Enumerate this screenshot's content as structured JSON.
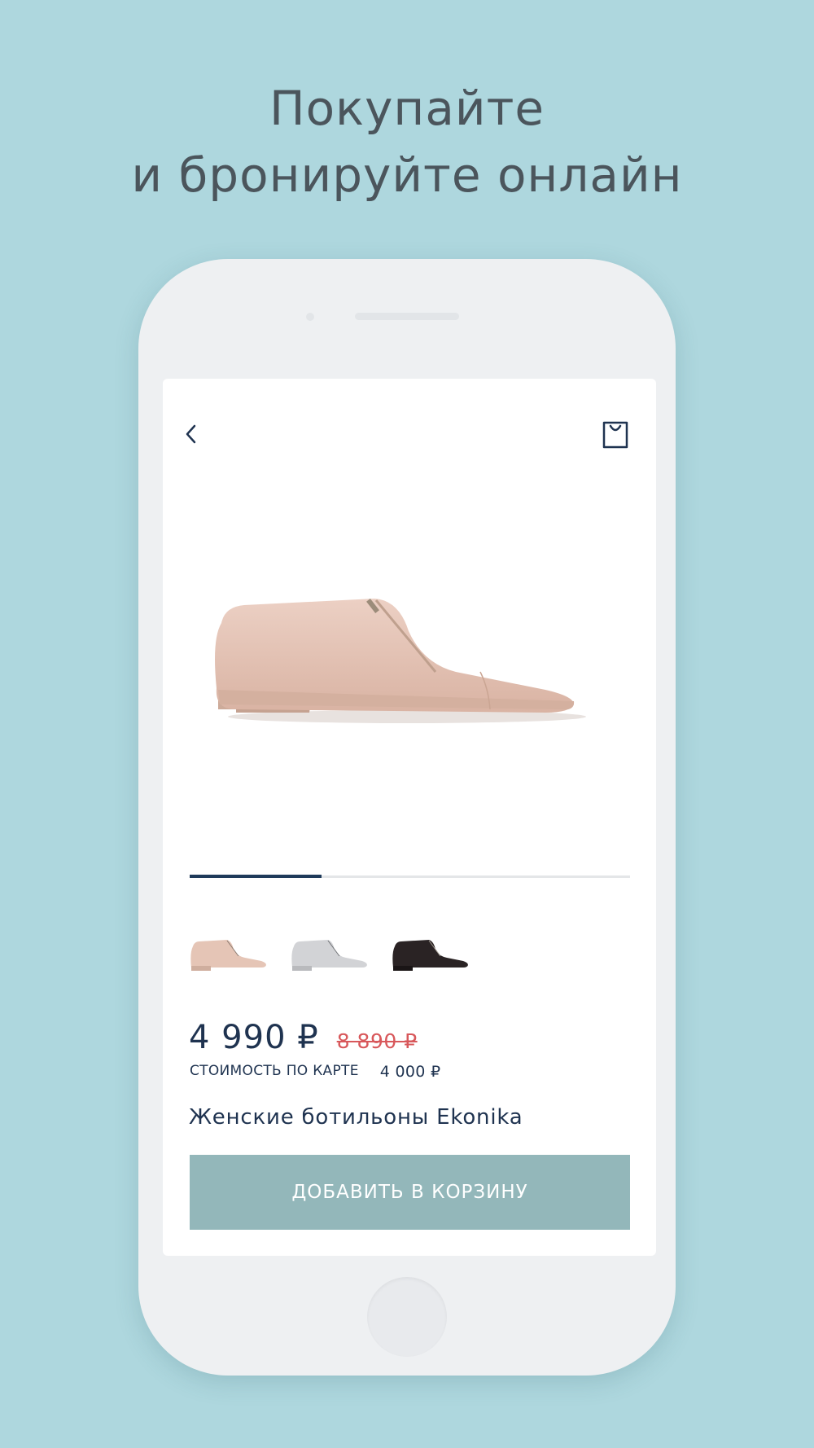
{
  "promo": {
    "headline_line1": "Покупайте",
    "headline_line2": "и бронируйте онлайн"
  },
  "screen": {
    "header": {
      "back_icon": "chevron-left-icon",
      "cart_icon": "shopping-bag-icon"
    },
    "gallery": {
      "progress": 0.3,
      "main_image_color": "#e7c7b9"
    },
    "color_options": [
      {
        "name": "beige-shoe-thumb",
        "color": "#e5c5b6"
      },
      {
        "name": "silver-shoe-thumb",
        "color": "#d2d3d6"
      },
      {
        "name": "black-shoe-thumb",
        "color": "#2a2324"
      }
    ],
    "price": {
      "current": "4 990 ₽",
      "old": "8 890 ₽",
      "card_label": "СТОИМОСТЬ ПО КАРТЕ",
      "card_value": "4 000 ₽"
    },
    "product_name": "Женские ботильоны Ekonika",
    "add_to_cart_label": "ДОБАВИТЬ В КОРЗИНУ"
  },
  "colors": {
    "background": "#aed7de",
    "accent_dark": "#1f3a5a",
    "old_price": "#d8585b",
    "button": "#93b7ba"
  }
}
